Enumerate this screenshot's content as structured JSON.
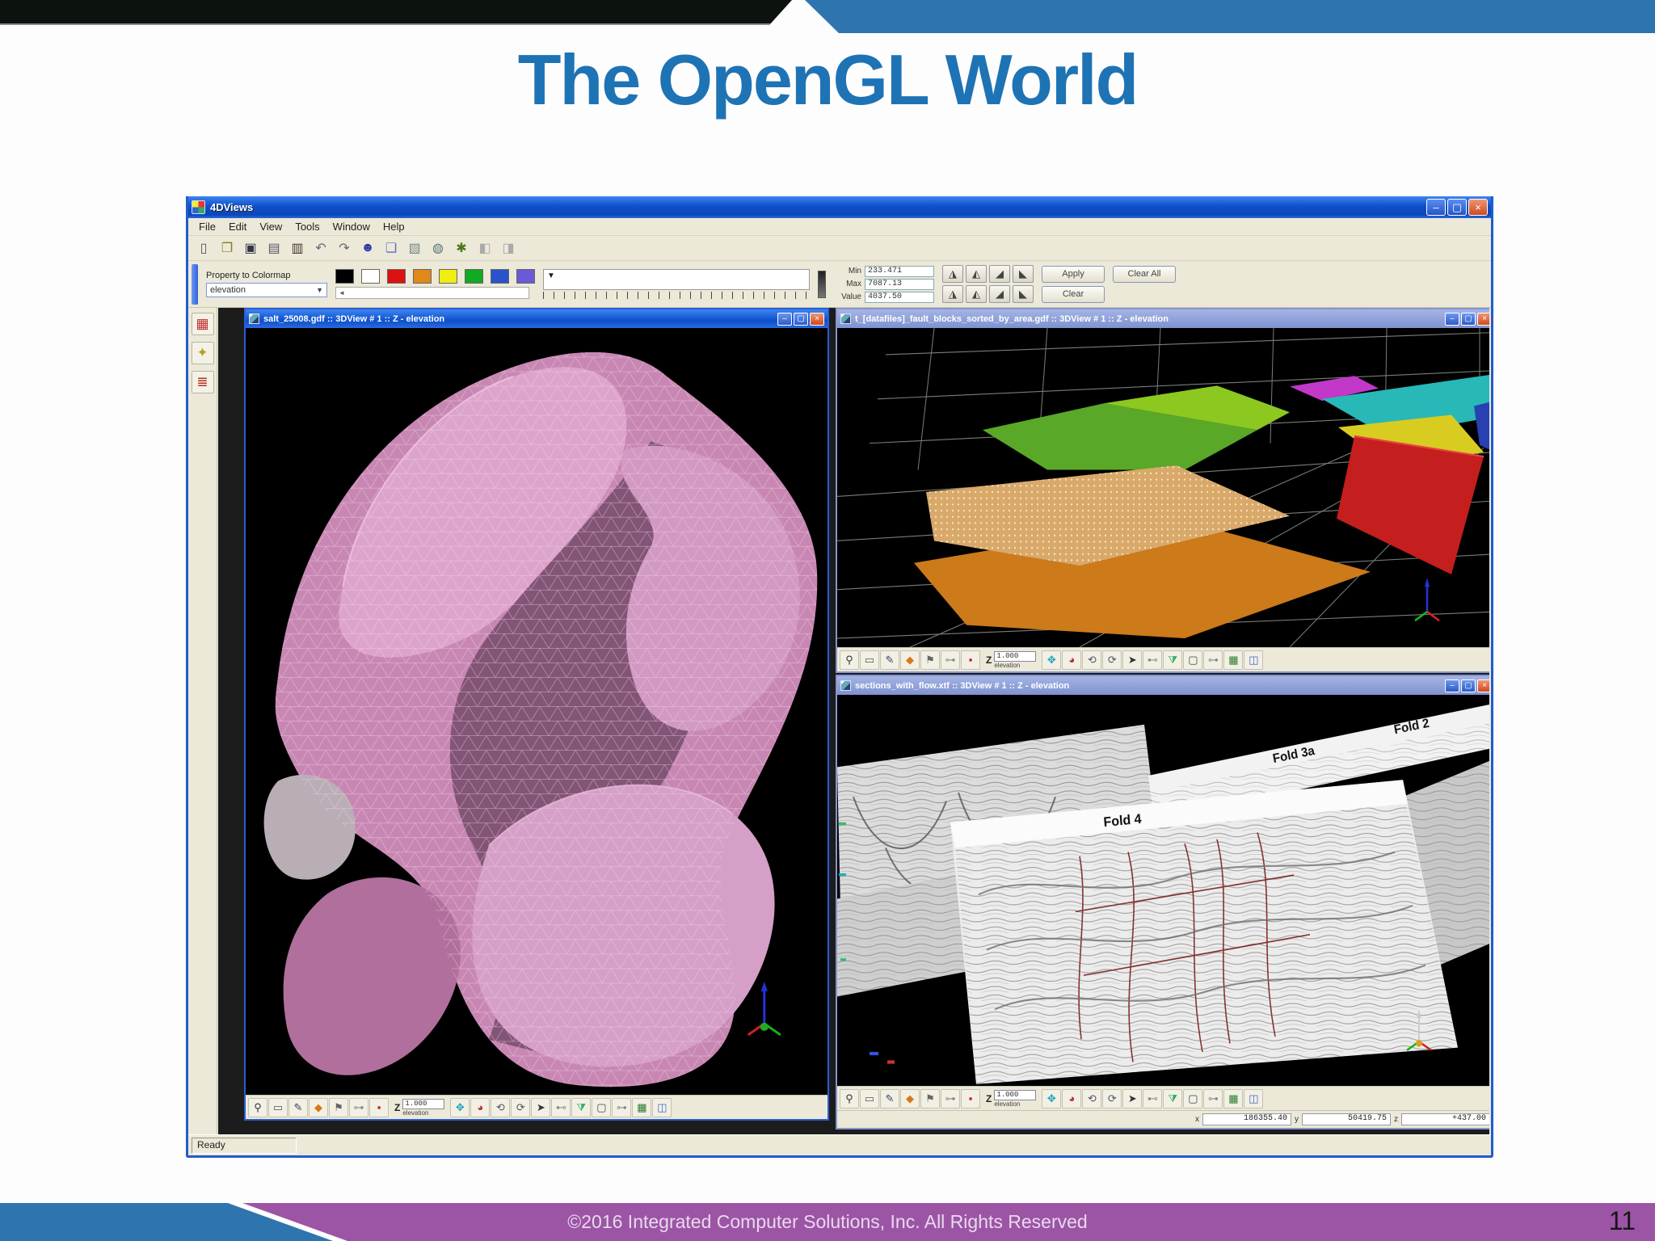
{
  "slide": {
    "title": "The OpenGL World",
    "footer": "©2016 Integrated Computer Solutions, Inc. All Rights Reserved",
    "page_number": "11",
    "colors": {
      "accent_blue": "#2e75b0",
      "title_blue": "#1e73b5",
      "footer_purple": "#9c55a5",
      "top_bar": "#0c120e"
    }
  },
  "app": {
    "title": "4DViews",
    "menu": [
      "File",
      "Edit",
      "View",
      "Tools",
      "Window",
      "Help"
    ],
    "window_buttons": [
      {
        "n": "minimize-button",
        "g": "–"
      },
      {
        "n": "maximize-button",
        "g": "▢"
      },
      {
        "n": "close-button",
        "g": "×"
      }
    ],
    "toolbar_main": [
      {
        "n": "new-file-icon",
        "g": "▯",
        "c": "#556"
      },
      {
        "n": "open-file-icon",
        "g": "❐",
        "c": "#8a7a1a"
      },
      {
        "n": "save-icon",
        "g": "▣",
        "c": "#334"
      },
      {
        "n": "print-icon",
        "g": "▤",
        "c": "#556"
      },
      {
        "n": "export-icon",
        "g": "▥",
        "c": "#433"
      },
      {
        "n": "undo-icon",
        "g": "↶",
        "c": "#667"
      },
      {
        "n": "redo-icon",
        "g": "↷",
        "c": "#667"
      },
      {
        "n": "user-icon",
        "g": "☻",
        "c": "#33a"
      },
      {
        "n": "copy-icon",
        "g": "❏",
        "c": "#66c"
      },
      {
        "n": "paste-icon",
        "g": "▧",
        "c": "#788"
      },
      {
        "n": "world-icon",
        "g": "◍",
        "c": "#577"
      },
      {
        "n": "snapshot-icon",
        "g": "✱",
        "c": "#4a7a1a"
      },
      {
        "n": "prev-view-icon",
        "g": "◧",
        "c": "#aaa"
      },
      {
        "n": "next-view-icon",
        "g": "◨",
        "c": "#aaa"
      }
    ],
    "colormap_panel": {
      "label": "Property to Colormap",
      "combo_value": "elevation",
      "swatches": [
        "#000000",
        "#ffffff",
        "#dd1111",
        "#e08818",
        "#eeee11",
        "#11aa22",
        "#2a52cc",
        "#6a5ad8"
      ],
      "colorbar_pointer": "▼",
      "min_label": "Min",
      "min_value": "233.471",
      "max_label": "Max",
      "max_value": "7087.13",
      "value_label": "Value",
      "value_value": "4037.50",
      "ramp_buttons": [
        "◮",
        "◭",
        "◢",
        "◣",
        "◮",
        "◭",
        "◢",
        "◣"
      ],
      "apply_label": "Apply",
      "clear_all_label": "Clear All",
      "clear_label": "Clear"
    },
    "sidebar_icons": [
      {
        "n": "palette-grid-icon",
        "g": "▦",
        "c": "#c03030"
      },
      {
        "n": "brush-icon",
        "g": "✦",
        "c": "#b8a020"
      },
      {
        "n": "layers-icon",
        "g": "≣",
        "c": "#b03020"
      }
    ],
    "view_toolbar": {
      "icons_left": [
        {
          "n": "zoom-icon",
          "g": "⚲",
          "c": "#333"
        },
        {
          "n": "select-icon",
          "g": "▭",
          "c": "#555"
        },
        {
          "n": "edit-icon",
          "g": "✎",
          "c": "#446"
        },
        {
          "n": "picker-icon",
          "g": "◆",
          "c": "#d97716"
        },
        {
          "n": "marker-icon",
          "g": "⚑",
          "c": "#666"
        },
        {
          "n": "ruler-slider-icon",
          "g": "⊶",
          "c": "#888"
        },
        {
          "n": "stop-icon",
          "g": "▪",
          "c": "#b42222"
        }
      ],
      "z_widget": {
        "label": "Z",
        "value": "1.000",
        "caption": "elevation"
      },
      "icons_right": [
        {
          "n": "move-icon",
          "g": "✥",
          "c": "#18a0b8"
        },
        {
          "n": "orbit-icon",
          "g": "◕",
          "c": "#b43030"
        },
        {
          "n": "rotate-x-icon",
          "g": "⟲",
          "c": "#556"
        },
        {
          "n": "rotate-y-icon",
          "g": "⟳",
          "c": "#556"
        },
        {
          "n": "pan-icon",
          "g": "➤",
          "c": "#333"
        },
        {
          "n": "speed-slider-icon",
          "g": "⊷",
          "c": "#888"
        },
        {
          "n": "drop-icon",
          "g": "⧩",
          "c": "#3a6"
        },
        {
          "n": "frame-icon",
          "g": "▢",
          "c": "#444"
        },
        {
          "n": "level-slider-icon",
          "g": "⊶",
          "c": "#888"
        },
        {
          "n": "grid-icon",
          "g": "▦",
          "c": "#2a7a2a"
        },
        {
          "n": "layout-icon",
          "g": "◫",
          "c": "#4466cc"
        }
      ]
    },
    "windows": {
      "left": {
        "title": "salt_25008.gdf :: 3DView # 1 :: Z - elevation"
      },
      "top_right": {
        "title": "t_[datafiles]_fault_blocks_sorted_by_area.gdf :: 3DView # 1 :: Z - elevation"
      },
      "bottom_right": {
        "title": "sections_with_flow.xtf :: 3DView # 1 :: Z - elevation",
        "labels": [
          "Fold 2",
          "Fold 3a",
          "Fold 4"
        ],
        "coords": {
          "x_label": "x",
          "x": "186355.40",
          "y_label": "y",
          "y": "50419.75",
          "z_label": "z",
          "z": "+437.00"
        }
      }
    },
    "status_bar": "Ready"
  }
}
